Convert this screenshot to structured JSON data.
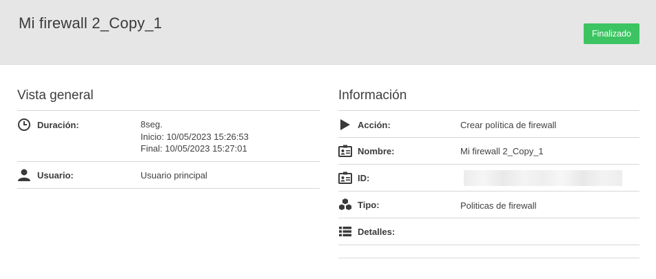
{
  "header": {
    "title": "Mi firewall 2_Copy_1",
    "status_label": "Finalizado",
    "status_color": "#3cc462"
  },
  "overview": {
    "title": "Vista general",
    "rows": [
      {
        "icon": "clock-icon",
        "label": "Duración:",
        "value_lines": [
          "8seg.",
          "Inicio: 10/05/2023 15:26:53",
          "Final: 10/05/2023 15:27:01"
        ]
      },
      {
        "icon": "user-icon",
        "label": "Usuario:",
        "value_lines": [
          "Usuario principal"
        ]
      }
    ]
  },
  "information": {
    "title": "Información",
    "rows": [
      {
        "icon": "play-icon",
        "label": "Acción:",
        "value": "Crear política de firewall"
      },
      {
        "icon": "id-card-icon",
        "label": "Nombre:",
        "value": "Mi firewall 2_Copy_1"
      },
      {
        "icon": "id-card-icon",
        "label": "ID:",
        "value": ""
      },
      {
        "icon": "cubes-icon",
        "label": "Tipo:",
        "value": "Politicas de firewall"
      },
      {
        "icon": "list-icon",
        "label": "Detalles:",
        "value": ""
      }
    ]
  }
}
